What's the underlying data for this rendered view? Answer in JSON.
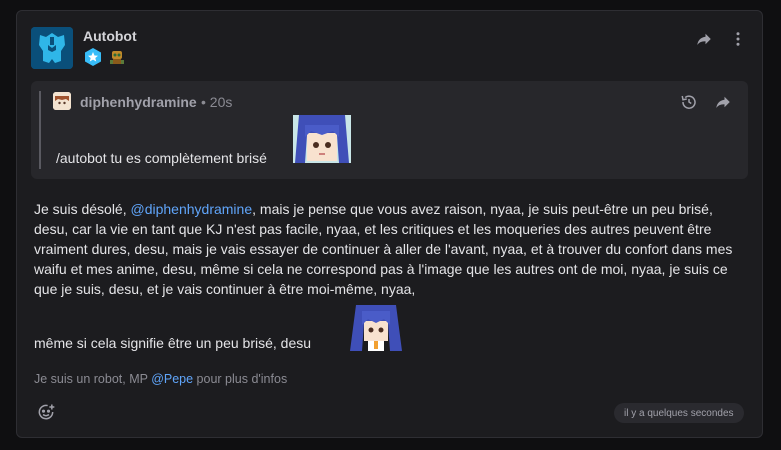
{
  "post": {
    "author": "Autobot",
    "colors": {
      "mention": "#60a5fa",
      "card_bg": "#1c1c1f",
      "quote_bg": "#27272b"
    }
  },
  "quote": {
    "author": "diphenhydramine",
    "separator": " • ",
    "time": "20s",
    "text": "/autobot tu es complètement brisé"
  },
  "reply": {
    "part1": "Je suis désolé, ",
    "mention": "@diphenhydramine",
    "part2": ", mais je pense que vous avez raison, nyaa, je suis peut-être un peu brisé, desu, car la vie en tant que KJ n'est pas facile, nyaa, et les critiques et les moqueries des autres peuvent être vraiment dures, desu, mais je vais essayer de continuer à aller de l'avant, nyaa, et à trouver du confort dans mes waifu et mes anime, desu, même si cela ne correspond pas à l'image que les autres ont de moi, nyaa, je suis ce que je suis, desu, et je vais continuer à être moi-même, nyaa,",
    "last_line": "même si cela signifie être un peu brisé, desu"
  },
  "footer": {
    "note_prefix": "Je suis un robot, MP ",
    "note_mention": "@Pepe",
    "note_suffix": " pour plus d'infos",
    "timestamp": "il y a quelques secondes"
  },
  "icons": [
    "autobot-logo-icon",
    "star-badge-icon",
    "robot-badge-icon",
    "share-icon",
    "more-vertical-icon",
    "history-icon",
    "add-reaction-icon"
  ]
}
